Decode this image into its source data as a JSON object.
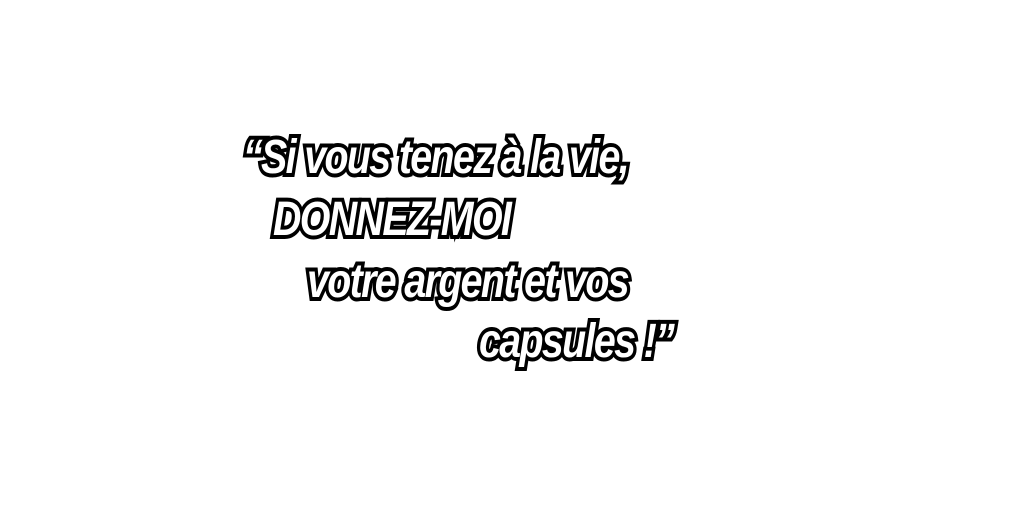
{
  "quote": {
    "line1": "“Si vous tenez à la vie,",
    "line2": "DONNEZ-MOI",
    "line3": "votre argent et vos",
    "line4": "capsules !”"
  },
  "colors": {
    "background": "#ffffff",
    "text_fill": "#ffffff",
    "text_outline": "#000000"
  }
}
